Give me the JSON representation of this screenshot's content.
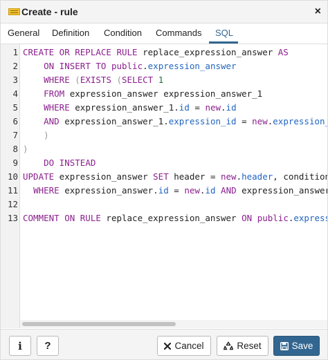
{
  "window": {
    "title": "Create - rule",
    "close_symbol": "×",
    "icon": "rule-icon"
  },
  "tabs": [
    {
      "label": "General"
    },
    {
      "label": "Definition"
    },
    {
      "label": "Condition"
    },
    {
      "label": "Commands"
    },
    {
      "label": "SQL",
      "active": true
    }
  ],
  "editor": {
    "line_numbers": [
      "1",
      "2",
      "3",
      "4",
      "5",
      "6",
      "7",
      "8",
      "9",
      "10",
      "11",
      "12",
      "13"
    ],
    "lines": [
      [
        [
          "kw",
          "CREATE OR REPLACE RULE"
        ],
        [
          "t",
          " replace_expression_answer "
        ],
        [
          "kw",
          "AS"
        ]
      ],
      [
        [
          "t",
          "    "
        ],
        [
          "kw",
          "ON INSERT TO"
        ],
        [
          "t",
          " "
        ],
        [
          "kw",
          "public"
        ],
        [
          "t",
          "."
        ],
        [
          "prop",
          "expression_answer"
        ]
      ],
      [
        [
          "t",
          "    "
        ],
        [
          "kw",
          "WHERE"
        ],
        [
          "t",
          " "
        ],
        [
          "punc",
          "("
        ],
        [
          "kw",
          "EXISTS"
        ],
        [
          "t",
          " "
        ],
        [
          "punc",
          "("
        ],
        [
          "kw",
          "SELECT"
        ],
        [
          "t",
          " "
        ],
        [
          "num",
          "1"
        ]
      ],
      [
        [
          "t",
          "    "
        ],
        [
          "kw",
          "FROM"
        ],
        [
          "t",
          " expression_answer expression_answer_1"
        ]
      ],
      [
        [
          "t",
          "    "
        ],
        [
          "kw",
          "WHERE"
        ],
        [
          "t",
          " expression_answer_1."
        ],
        [
          "prop",
          "id"
        ],
        [
          "t",
          " = "
        ],
        [
          "kw",
          "new"
        ],
        [
          "t",
          "."
        ],
        [
          "prop",
          "id"
        ]
      ],
      [
        [
          "t",
          "    "
        ],
        [
          "kw",
          "AND"
        ],
        [
          "t",
          " expression_answer_1."
        ],
        [
          "prop",
          "expression_id"
        ],
        [
          "t",
          " = "
        ],
        [
          "kw",
          "new"
        ],
        [
          "t",
          "."
        ],
        [
          "prop",
          "expression_id"
        ]
      ],
      [
        [
          "t",
          "    "
        ],
        [
          "punc",
          ")"
        ]
      ],
      [
        [
          "punc",
          ")"
        ]
      ],
      [
        [
          "t",
          "    "
        ],
        [
          "kw",
          "DO INSTEAD"
        ]
      ],
      [
        [
          "kw",
          "UPDATE"
        ],
        [
          "t",
          " expression_answer "
        ],
        [
          "kw",
          "SET"
        ],
        [
          "t",
          " header = "
        ],
        [
          "kw",
          "new"
        ],
        [
          "t",
          "."
        ],
        [
          "prop",
          "header"
        ],
        [
          "t",
          ", condition"
        ]
      ],
      [
        [
          "t",
          "  "
        ],
        [
          "kw",
          "WHERE"
        ],
        [
          "t",
          " expression_answer."
        ],
        [
          "prop",
          "id"
        ],
        [
          "t",
          " = "
        ],
        [
          "kw",
          "new"
        ],
        [
          "t",
          "."
        ],
        [
          "prop",
          "id"
        ],
        [
          "t",
          " "
        ],
        [
          "kw",
          "AND"
        ],
        [
          "t",
          " expression_answer"
        ]
      ],
      [],
      [
        [
          "kw",
          "COMMENT ON RULE"
        ],
        [
          "t",
          " replace_expression_answer "
        ],
        [
          "kw",
          "ON"
        ],
        [
          "t",
          " "
        ],
        [
          "kw",
          "public"
        ],
        [
          "t",
          "."
        ],
        [
          "prop",
          "expression_answer"
        ]
      ]
    ]
  },
  "footer": {
    "info_label": "i",
    "help_label": "?",
    "cancel_label": "Cancel",
    "reset_label": "Reset",
    "save_label": "Save"
  },
  "colors": {
    "accent": "#326690",
    "keyword": "#8b1f8e",
    "property": "#2165c0",
    "number": "#1f6e3c"
  }
}
